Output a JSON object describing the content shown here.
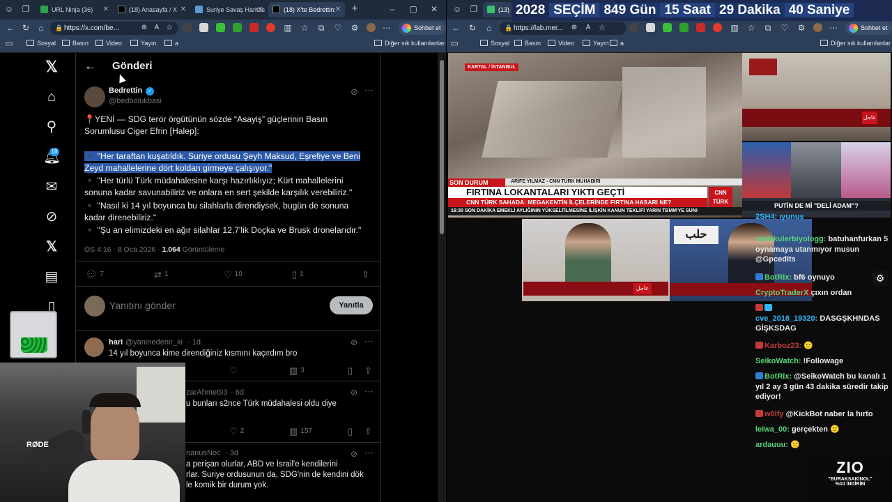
{
  "left_browser": {
    "tabs": [
      {
        "label": "URL Ninja (36)",
        "active": false
      },
      {
        "label": "(18) Anasayfa / X",
        "active": false
      },
      {
        "label": "Suriye Savaş Haritas",
        "active": false
      },
      {
        "label": "(18) X'te Bedrettin:",
        "active": true
      }
    ],
    "url": "https://x.com/be...",
    "copilot_label": "Sohbet et",
    "bookmarks": [
      "Sosyal",
      "Basın",
      "Video",
      "Yayın",
      "a"
    ],
    "other_bookmarks": "Diğer sık kullanılanlar"
  },
  "right_browser": {
    "tab_label": "(13)",
    "url": "https://lab.mer...",
    "copilot_label": "Sohbet et",
    "bookmarks": [
      "Sosyal",
      "Basın",
      "Video",
      "Yayın",
      "a"
    ],
    "other_bookmarks": "Diğer sık kullanılanlar"
  },
  "countdown": {
    "year": "2028",
    "label": "SEÇİM",
    "days": "849 Gün",
    "hours": "15 Saat",
    "minutes": "29 Dakika",
    "seconds": "40 Saniye"
  },
  "x_nav": {
    "notification_count": "18"
  },
  "post": {
    "page_title": "Gönderi",
    "author_name": "Bedrettin",
    "author_handle": "@bedbolukbasi",
    "lines": [
      "📍YENİ — SDG terör örgütünün sözde “Asayiş” güçlerinin Basın",
      "Sorumlusu Ciger Efrin [Halep]:",
      "",
      "▪️ \"Her taraftan kuşatıldık. Suriye ordusu Şeyh Maksud, Eşrefiye ve Beni",
      "Zeyd mahallelerine dört koldan girmeye çalışıyor.\"",
      "▪️ \"Her türlü Türk müdahalesine karşı hazırlıklıyız; Kürt mahallelerini",
      "sonuna kadar savunabiliriz ve onlara en sert şekilde karşılık verebiliriz.\"",
      "▪️ \"Nasıl ki 14 yıl boyunca bu silahlarla direndiysek, bugün de sonuna",
      "kadar direnebiliriz.\"",
      "▪️ \"Şu an elimizdeki en ağır silahlar 12.7'lik Doçka ve Brusk dronelarıdır.\""
    ],
    "time": "ÖS 4:16 · 8 Oca 2026 · ",
    "views": "1.064",
    "views_label": " Görüntüleme",
    "replies": "7",
    "reposts": "1",
    "likes": "10",
    "bookmarks": "1",
    "reply_placeholder": "Yanıtını gönder",
    "reply_button": "Yanıtla"
  },
  "replies": [
    {
      "name": "hari",
      "handle": "@yaninedenir_ki",
      "age": "· 1d",
      "text": "14 yıl boyunca kime direndiğiniz kısmını kaçırdım bro",
      "likes": "",
      "views": "3"
    },
    {
      "name": "",
      "handle": "zarAhmet93",
      "age": "· 6d",
      "text": "u bunları s2nce Türk müdahalesi oldu diye",
      "likes": "2",
      "views": "157"
    },
    {
      "name": "",
      "handle": "nariusNoc",
      "age": "· 3d",
      "text_lines": [
        "a perişan olurlar, ABD ve İsrail'e kendilerini",
        "rlar. Suriye ordusunun da, SDG'nin de kendini dök",
        "le komik bir durum yok."
      ]
    }
  ],
  "news": {
    "cnn_location": "KARTAL / İSTANBUL",
    "cnn_reporter": "ARİFE YILMAZ - CNN TÜRK MUHABİRİ",
    "cnn_ticker_left": "SON DURUM",
    "cnn_headline": "FIRTINA LOKANTALARI YIKTI GEÇTİ",
    "cnn_subheadline": "CNN TÜRK SAHADA: MEGAKENTİN İLÇELERİNDE FIRTINA HASARI NE?",
    "cnn_time": "16:30",
    "cnn_ticker": "SON DAKİKA   EMEKLİ AYLIĞININ YÜKSELTİLMESİNE İLİŞKİN KANUN TEKLİFİ YARIN TBMM'YE SUNI",
    "cnn_logo": "CNN TÜRK",
    "aljazeera_badge": "عاجل",
    "putin_headline": "PUTİN DE Mİ \"DELİ ADAM\"?",
    "sign_text": "حلب"
  },
  "chat": [
    {
      "user": "",
      "color": "#2fb8ff",
      "msg": "2SH4: ıyunus"
    },
    {
      "user": "molekulerbiyologg:",
      "color": "#57d47a",
      "msg": "batuhanfurkan 5 oynamaya utanmıyor musun @Gpcedits"
    },
    {
      "user": "BotRix:",
      "color": "#57d47a",
      "msg": "bf6 oynuyo"
    },
    {
      "user": "CryptoTraderX",
      "color": "#57d47a",
      "msg": "çıxın ordan"
    },
    {
      "user": "cve_2018_19320:",
      "color": "#2fb8ff",
      "msg": "DASGŞKHNDAS GİŞKSDAG"
    },
    {
      "user": "Karboz23:",
      "color": "#c13b3b",
      "msg": "🙂"
    },
    {
      "user": "SeikoWatch:",
      "color": "#57d47a",
      "msg": "!Followage"
    },
    {
      "user": "BotRix:",
      "color": "#57d47a",
      "msg": "@SeikoWatch bu kanalı 1 yıl 2 ay 3 gün 43 dakika süredir takip ediyor!"
    },
    {
      "user": "w0lfy",
      "color": "#c13b3b",
      "msg": "@KickBot naber la hırto"
    },
    {
      "user": "leiwa_00:",
      "color": "#57d47a",
      "msg": "gerçekten 🙂"
    },
    {
      "user": "ardauuu:",
      "color": "#57d47a",
      "msg": "🙂"
    }
  ],
  "promo": {
    "brand": "ZIO",
    "line1": "\"BURAKSAKINOL\"",
    "line2": "%10 İNDİRİM"
  },
  "webcam": {
    "mic_brand": "RØDE"
  }
}
